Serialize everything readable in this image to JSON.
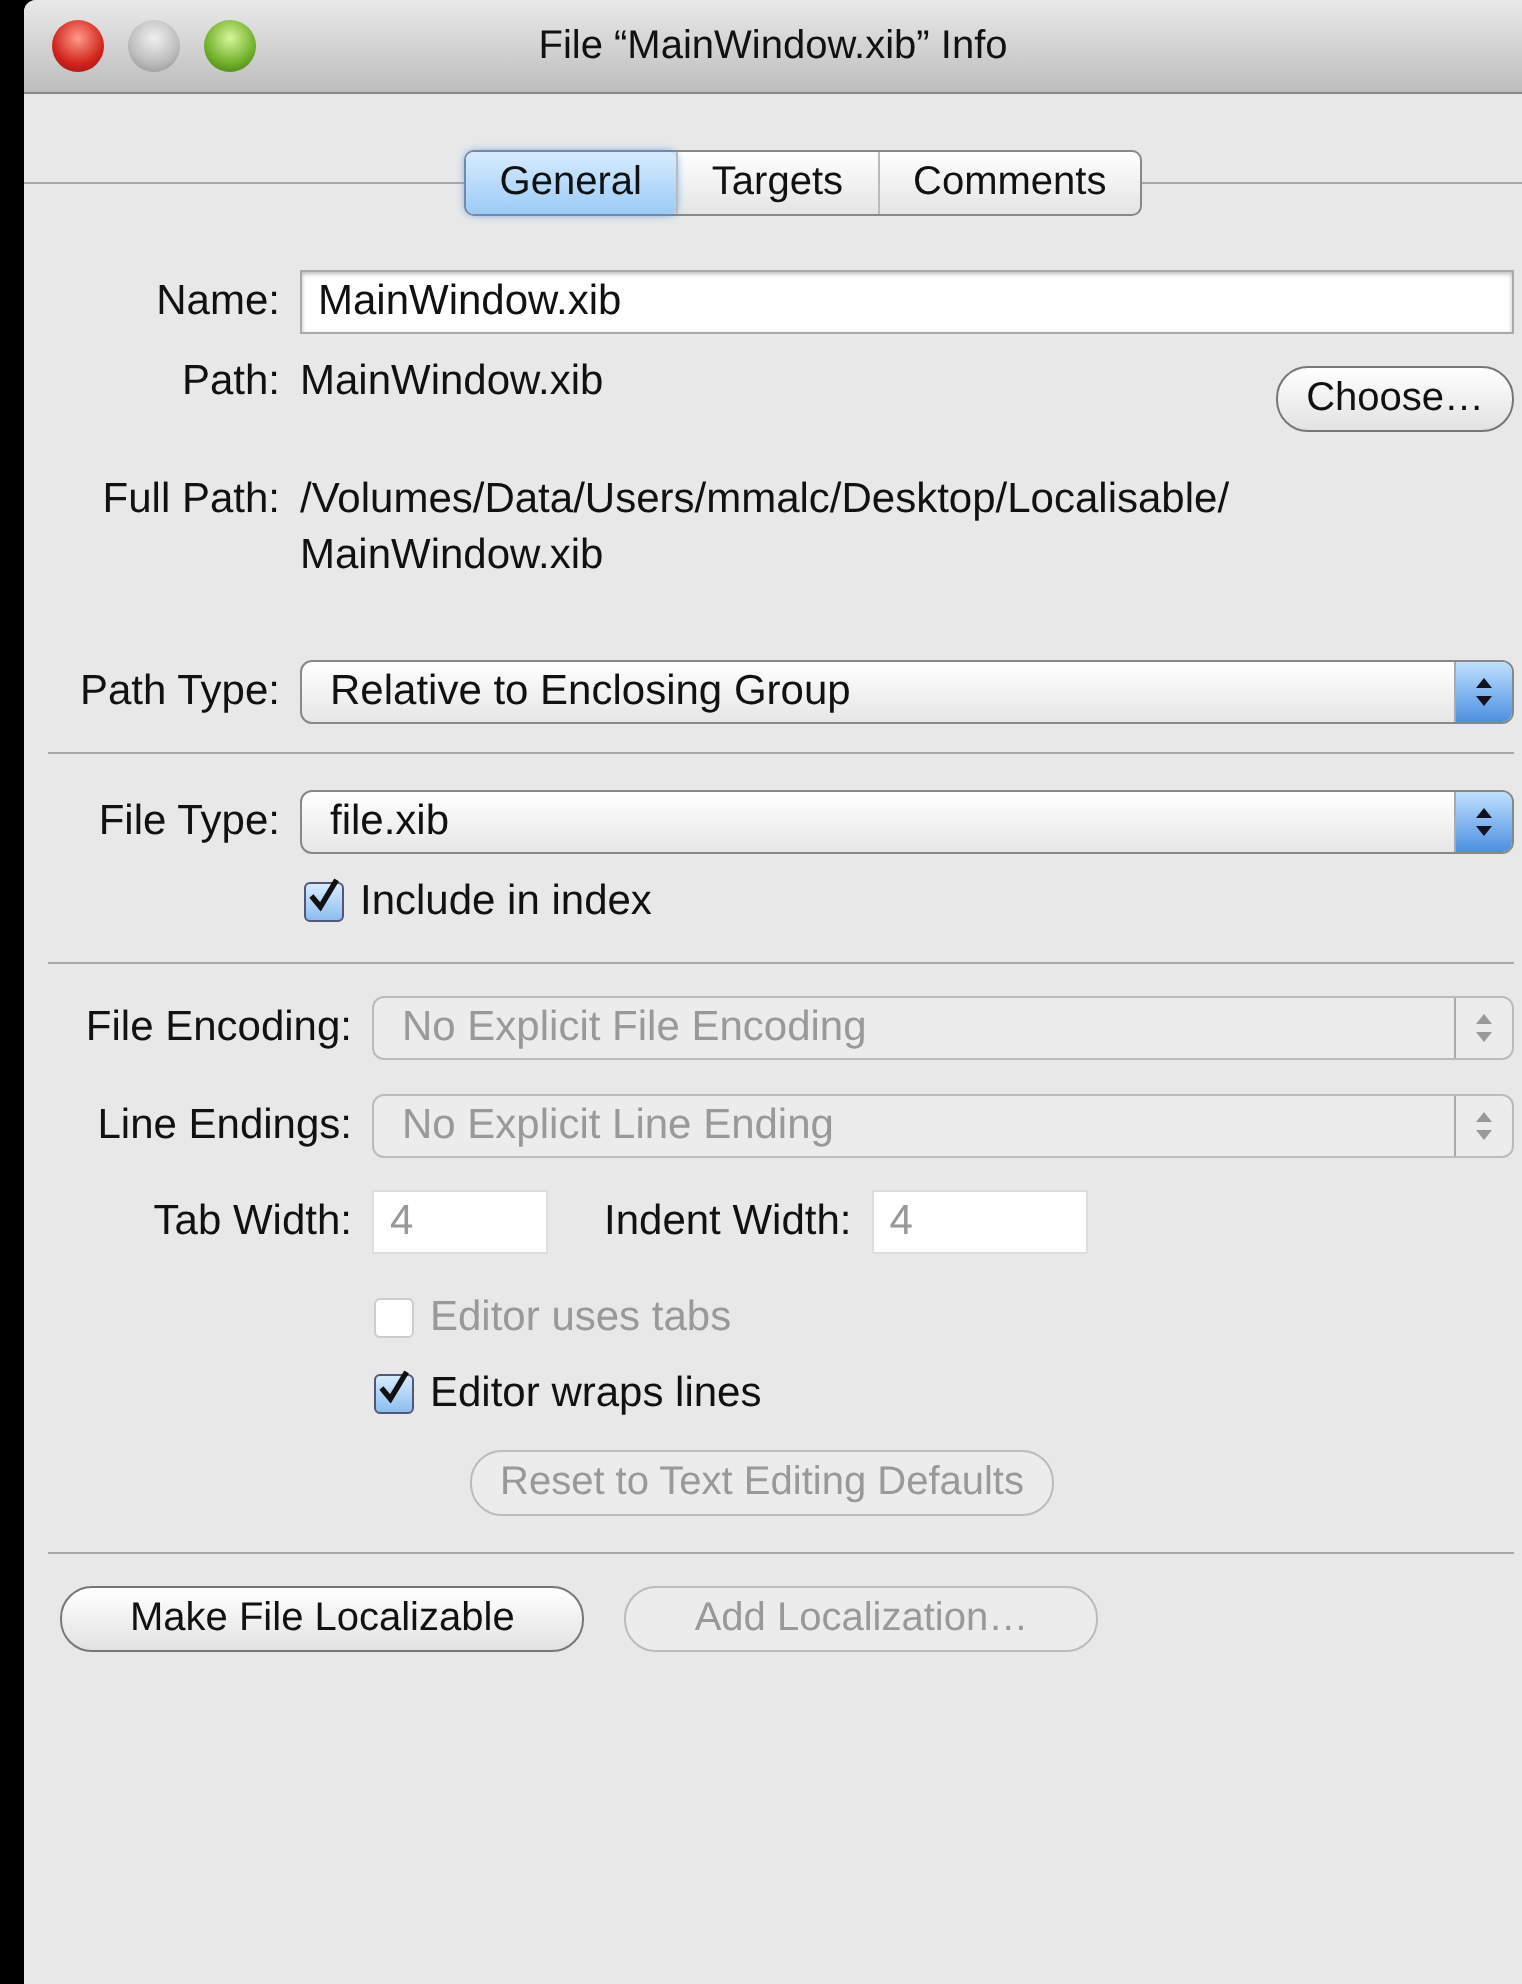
{
  "window": {
    "title": "File “MainWindow.xib” Info"
  },
  "tabs": [
    {
      "label": "General",
      "selected": true
    },
    {
      "label": "Targets",
      "selected": false
    },
    {
      "label": "Comments",
      "selected": false
    }
  ],
  "name": {
    "label": "Name:",
    "value": "MainWindow.xib"
  },
  "path": {
    "label": "Path:",
    "value": "MainWindow.xib",
    "button": "Choose…"
  },
  "full_path": {
    "label": "Full Path:",
    "lines": [
      "/Volumes/Data/Users/mmalc/Desktop/Localisable/",
      "MainWindow.xib"
    ]
  },
  "path_type": {
    "label": "Path Type:",
    "value": "Relative to Enclosing Group",
    "disabled": false
  },
  "file_type": {
    "label": "File Type:",
    "value": "file.xib",
    "disabled": false
  },
  "include_in_index": {
    "label": "Include in index",
    "checked": true,
    "disabled": false
  },
  "file_encoding": {
    "label": "File Encoding:",
    "value": "No Explicit File Encoding",
    "disabled": true
  },
  "line_endings": {
    "label": "Line Endings:",
    "value": "No Explicit Line Ending",
    "disabled": true
  },
  "tab_width": {
    "label": "Tab Width:",
    "value": "4",
    "disabled": true
  },
  "indent_width": {
    "label": "Indent Width:",
    "value": "4",
    "disabled": true
  },
  "editor_options": [
    {
      "label": "Editor uses tabs",
      "checked": false,
      "disabled": true
    },
    {
      "label": "Editor wraps lines",
      "checked": true,
      "disabled": false
    }
  ],
  "reset_button": {
    "label": "Reset to Text Editing Defaults",
    "disabled": true
  },
  "buttons": [
    {
      "label": "Make File Localizable",
      "disabled": false
    },
    {
      "label": "Add Localization…",
      "disabled": true
    }
  ]
}
